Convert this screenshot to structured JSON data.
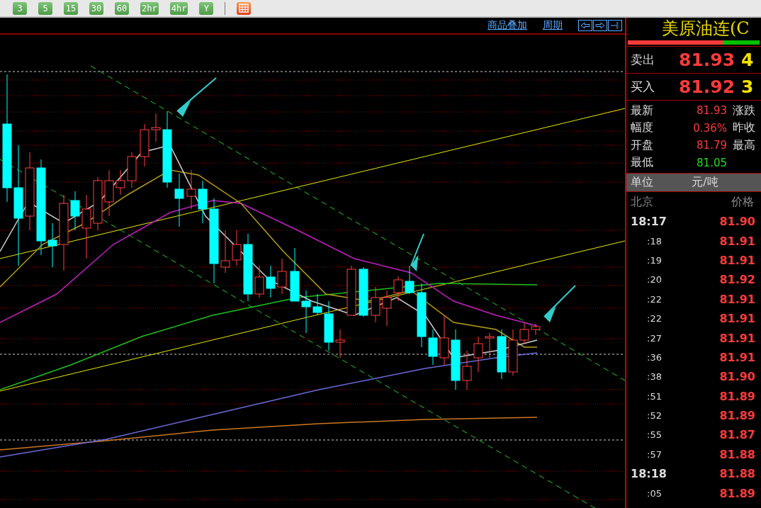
{
  "toolbar": {
    "periods": [
      {
        "label": "3"
      },
      {
        "label": "5"
      },
      {
        "label": "15"
      },
      {
        "label": "30"
      },
      {
        "label": "60"
      },
      {
        "label": "2hr"
      },
      {
        "label": "4hr"
      },
      {
        "label": "Y"
      }
    ]
  },
  "chart_header": {
    "links": [
      "商品叠加",
      "周期"
    ]
  },
  "quote": {
    "title": "美原油连(C",
    "level": 0.72,
    "sell": {
      "label": "卖出",
      "price": "81.93",
      "volume": "4"
    },
    "buy": {
      "label": "买入",
      "price": "81.92",
      "volume": "3"
    },
    "stats": [
      {
        "label": "最新",
        "value": "81.93",
        "color": "#ff3b3b",
        "label_2": "涨跌"
      },
      {
        "label": "幅度",
        "value": "0.36%",
        "color": "#ff3b3b",
        "label_2": "昨收"
      },
      {
        "label": "开盘",
        "value": "81.79",
        "color": "#ff3b3b",
        "label_2": "最高"
      },
      {
        "label": "最低",
        "value": "81.05",
        "color": "#22dd22"
      }
    ],
    "unit": {
      "label": "单位",
      "value": "元/吨"
    },
    "ticks_header": {
      "time": "北京",
      "price": "价格"
    },
    "ticks": [
      {
        "time": "18:17",
        "kind": "hour",
        "price": "81.90"
      },
      {
        "time": ":18",
        "kind": "minute",
        "price": "81.91"
      },
      {
        "time": ":19",
        "kind": "minute",
        "price": "81.91"
      },
      {
        "time": ":20",
        "kind": "minute",
        "price": "81.92"
      },
      {
        "time": ":22",
        "kind": "minute",
        "price": "81.91"
      },
      {
        "time": ":22",
        "kind": "minute",
        "price": "81.91"
      },
      {
        "time": ":27",
        "kind": "minute",
        "price": "81.91"
      },
      {
        "time": ":36",
        "kind": "minute",
        "price": "81.91"
      },
      {
        "time": ":38",
        "kind": "minute",
        "price": "81.90"
      },
      {
        "time": ":51",
        "kind": "minute",
        "price": "81.89"
      },
      {
        "time": ":52",
        "kind": "minute",
        "price": "81.89"
      },
      {
        "time": ":55",
        "kind": "minute",
        "price": "81.87"
      },
      {
        "time": ":57",
        "kind": "minute",
        "price": "81.88"
      },
      {
        "time": "18:18",
        "kind": "hour",
        "price": "81.88"
      },
      {
        "time": ":05",
        "kind": "minute",
        "price": "81.89"
      }
    ]
  }
}
